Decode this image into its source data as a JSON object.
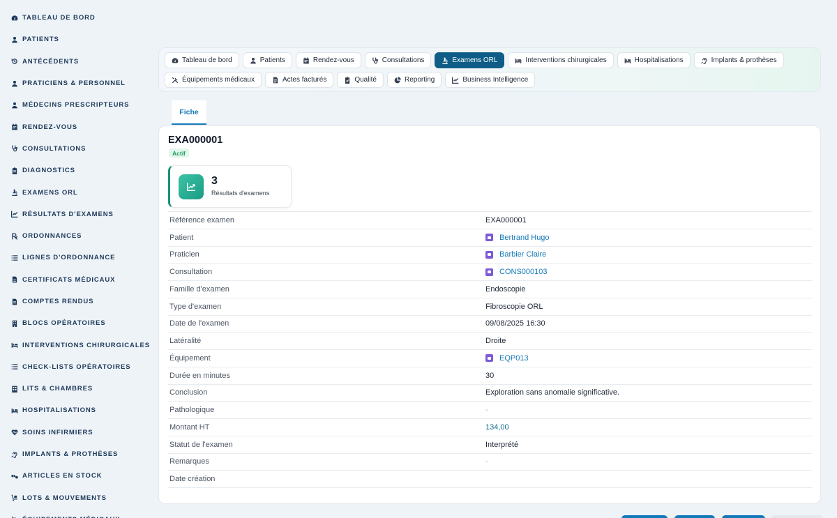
{
  "sidebar": {
    "items": [
      {
        "label": "TABLEAU DE BORD",
        "icon": "gauge-icon"
      },
      {
        "label": "PATIENTS",
        "icon": "user-icon"
      },
      {
        "label": "ANTÉCÉDENTS",
        "icon": "history-icon"
      },
      {
        "label": "PRATICIENS & PERSONNEL",
        "icon": "user-doctor-icon"
      },
      {
        "label": "MÉDECINS PRESCRIPTEURS",
        "icon": "user-md-icon"
      },
      {
        "label": "RENDEZ-VOUS",
        "icon": "calendar-icon"
      },
      {
        "label": "CONSULTATIONS",
        "icon": "stethoscope-icon"
      },
      {
        "label": "DIAGNOSTICS",
        "icon": "clipboard-icon"
      },
      {
        "label": "EXAMENS ORL",
        "icon": "microscope-icon"
      },
      {
        "label": "RÉSULTATS D'EXAMENS",
        "icon": "chart-line-icon"
      },
      {
        "label": "ORDONNANCES",
        "icon": "prescription-icon"
      },
      {
        "label": "LIGNES D'ORDONNANCE",
        "icon": "list-icon"
      },
      {
        "label": "CERTIFICATS MÉDICAUX",
        "icon": "file-icon"
      },
      {
        "label": "COMPTES RENDUS",
        "icon": "file-text-icon"
      },
      {
        "label": "BLOCS OPÉRATOIRES",
        "icon": "building-icon"
      },
      {
        "label": "INTERVENTIONS CHIRURGICALES",
        "icon": "bed-icon"
      },
      {
        "label": "CHECK-LISTS OPÉRATOIRES",
        "icon": "checklist-icon"
      },
      {
        "label": "LITS & CHAMBRES",
        "icon": "room-icon"
      },
      {
        "label": "HOSPITALISATIONS",
        "icon": "bed-icon"
      },
      {
        "label": "SOINS INFIRMIERS",
        "icon": "heart-pulse-icon"
      },
      {
        "label": "IMPLANTS & PROTHÈSES",
        "icon": "ear-icon"
      },
      {
        "label": "ARTICLES EN STOCK",
        "icon": "pills-icon"
      },
      {
        "label": "LOTS & MOUVEMENTS",
        "icon": "dolly-icon"
      },
      {
        "label": "ÉQUIPEMENTS MÉDICAUX",
        "icon": "tools-icon"
      }
    ]
  },
  "toolbar": {
    "row1": [
      {
        "label": "Tableau de bord",
        "icon": "gauge-icon",
        "active": false
      },
      {
        "label": "Patients",
        "icon": "user-icon",
        "active": false
      },
      {
        "label": "Rendez-vous",
        "icon": "calendar-icon",
        "active": false
      },
      {
        "label": "Consultations",
        "icon": "stethoscope-icon",
        "active": false
      },
      {
        "label": "Examens ORL",
        "icon": "microscope-icon",
        "active": true
      },
      {
        "label": "Interventions chirurgicales",
        "icon": "bed-icon",
        "active": false
      },
      {
        "label": "Hospitalisations",
        "icon": "bed-icon",
        "active": false
      },
      {
        "label": "Implants & prothèses",
        "icon": "ear-icon",
        "active": false
      }
    ],
    "row2": [
      {
        "label": "Équipements médicaux",
        "icon": "tools-icon",
        "active": false
      },
      {
        "label": "Actes facturés",
        "icon": "file-invoice-icon",
        "active": false
      },
      {
        "label": "Qualité",
        "icon": "clipboard-check-icon",
        "active": false
      },
      {
        "label": "Reporting",
        "icon": "pie-chart-icon",
        "active": false
      },
      {
        "label": "Business Intelligence",
        "icon": "chart-line-icon",
        "active": false
      }
    ]
  },
  "tab": {
    "label": "Fiche"
  },
  "record": {
    "title": "EXA000001",
    "status": "Actif",
    "stat": {
      "value": "3",
      "label": "Résultats d'examens",
      "icon": "chart-line-icon"
    }
  },
  "details": [
    {
      "label": "Référence examen",
      "value": "EXA000001",
      "type": "text"
    },
    {
      "label": "Patient",
      "value": "Bertrand Hugo",
      "type": "link"
    },
    {
      "label": "Praticien",
      "value": "Barbier Claire",
      "type": "link"
    },
    {
      "label": "Consultation",
      "value": "CONS000103",
      "type": "link"
    },
    {
      "label": "Famille d'examen",
      "value": "Endoscopie",
      "type": "text"
    },
    {
      "label": "Type d'examen",
      "value": "Fibroscopie ORL",
      "type": "text"
    },
    {
      "label": "Date de l'examen",
      "value": "09/08/2025 16:30",
      "type": "text"
    },
    {
      "label": "Latéralité",
      "value": "Droite",
      "type": "text"
    },
    {
      "label": "Équipement",
      "value": "EQP013",
      "type": "link"
    },
    {
      "label": "Durée en minutes",
      "value": "30",
      "type": "text"
    },
    {
      "label": "Conclusion",
      "value": "Exploration sans anomalie significative.",
      "type": "text"
    },
    {
      "label": "Pathologique",
      "value": "-",
      "type": "empty"
    },
    {
      "label": "Montant HT",
      "value": "134,00",
      "type": "money"
    },
    {
      "label": "Statut de l'examen",
      "value": "Interprété",
      "type": "text"
    },
    {
      "label": "Remarques",
      "value": "-",
      "type": "empty"
    },
    {
      "label": "Date création",
      "value": "",
      "type": "text"
    }
  ],
  "colors": {
    "accent": "#0f5d87",
    "link": "#1479b8",
    "success": "#1f9d63",
    "stat_teal": "#1a9b86",
    "link_icon": "#7c5cd6"
  }
}
